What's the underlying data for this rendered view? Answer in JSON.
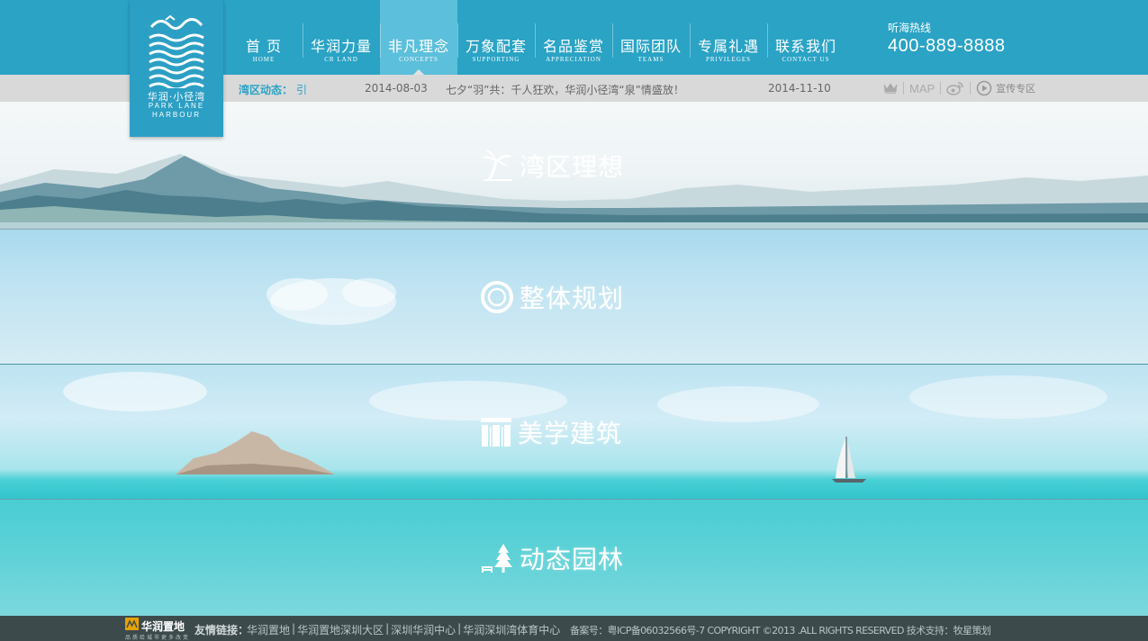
{
  "brand": {
    "logo_cn": "华润·小径湾",
    "logo_en_line1": "PARK LANE",
    "logo_en_line2": "HARBOUR"
  },
  "nav": [
    {
      "cn": "首 页",
      "en": "HOME"
    },
    {
      "cn": "华润力量",
      "en": "CR LAND"
    },
    {
      "cn": "非凡理念",
      "en": "CONCEPTS"
    },
    {
      "cn": "万象配套",
      "en": "SUPPORTING"
    },
    {
      "cn": "名品鉴赏",
      "en": "APPRECIATION"
    },
    {
      "cn": "国际团队",
      "en": "TEAMS"
    },
    {
      "cn": "专属礼遇",
      "en": "PRIVILEGES"
    },
    {
      "cn": "联系我们",
      "en": "CONTACT US"
    }
  ],
  "active_nav": "非凡理念",
  "hotline": {
    "label": "听海热线",
    "number": "400-889-8888"
  },
  "news": {
    "label": "湾区动态：",
    "cut_text": "引",
    "items": [
      {
        "date": "2014-08-03",
        "title": "七夕“羽”共：千人狂欢，华润小径湾“泉”情盛放！"
      },
      {
        "date": "2014-11-10",
        "title": ""
      }
    ]
  },
  "tools": {
    "map": "MAP",
    "promo": "宣传专区",
    "icons": [
      "crown-icon",
      "weibo-icon",
      "play-icon"
    ]
  },
  "panels": [
    {
      "title": "湾区理想",
      "icon": "palm-tree-icon"
    },
    {
      "title": "整体规划",
      "icon": "ring-icon"
    },
    {
      "title": "美学建筑",
      "icon": "building-icon"
    },
    {
      "title": "动态园林",
      "icon": "pine-tree-icon"
    }
  ],
  "footer": {
    "logo_cn": "华润置地",
    "logo_sub": "品质给城市更多改变",
    "links_label": "友情链接：",
    "links": [
      "华润置地",
      "华润置地深圳大区",
      "深圳华润中心",
      "华润深圳湾体育中心"
    ],
    "copyright": "备案号：粤ICP备06032566号-7  COPYRIGHT ©2013 .ALL RIGHTS RESERVED  技术支持：牧星策划"
  },
  "colors": {
    "header_blue": "#2aa3c5",
    "active_tab": "#5cbfdb",
    "news_bar": "#d9d9d9",
    "footer": "#3d4a4c"
  }
}
